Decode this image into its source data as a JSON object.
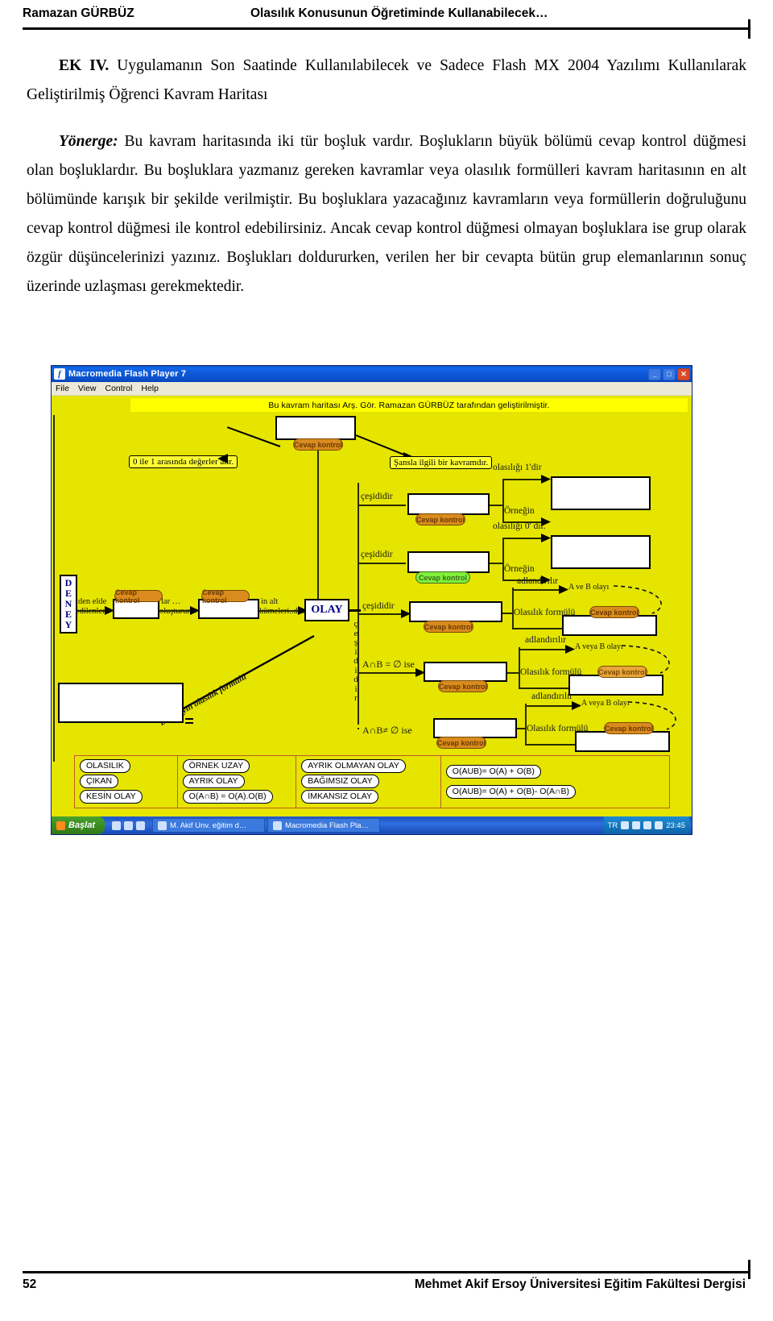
{
  "running_head": {
    "left": "Ramazan GÜRBÜZ",
    "right": "Olasılık Konusunun Öğretiminde Kullanabilecek…"
  },
  "document": {
    "ek_label": "EK IV.",
    "ek_title": " Uygulamanın Son Saatinde Kullanılabilecek ve Sadece Flash MX 2004 Yazılımı Kullanılarak Geliştirilmiş Öğrenci Kavram Haritası",
    "yonerge_label": "Yönerge:",
    "yonerge_text": " Bu kavram haritasında iki tür boşluk vardır. Boşlukların büyük bölümü cevap kontrol düğmesi olan boşluklardır. Bu boşluklara yazmanız gereken kavramlar veya olasılık formülleri kavram haritasının en alt bölümünde karışık bir şekilde verilmiştir. Bu boşluklara yazacağınız kavramların veya formüllerin doğruluğunu cevap kontrol düğmesi ile kontrol edebilirsiniz. Ancak cevap kontrol düğmesi olmayan boşluklara ise grup olarak özgür düşüncelerinizi yazınız. Boşlukları doldururken, verilen her bir cevapta bütün grup elemanlarının sonuç üzerinde uzlaşması gerekmektedir."
  },
  "flash_window": {
    "title": "Macromedia Flash Player 7",
    "icon": "flash-icon",
    "window_buttons": {
      "minimize": "_",
      "maximize": "□",
      "close": "✕"
    },
    "menu": [
      "File",
      "View",
      "Control",
      "Help"
    ]
  },
  "stage": {
    "banner": "Bu kavram haritası Arş. Gör. Ramazan GÜRBÜZ tarafından geliştirilmiştir.",
    "background_color": "#e5e500",
    "banner_color": "#ffff00",
    "labels": {
      "zero_one": "0 ile 1 arasında değerler alır.",
      "sans": "Şansla ilgili bir kavramdır.",
      "deney": "DENEY",
      "olay": "OLAY",
      "den_elde": "den elde",
      "edilenler": "edilenler",
      "lar": "lar …",
      "olusturur": "oluşturur",
      "in_alt": "in alt",
      "kumeleri": "kümeleri..dır.",
      "bir_olayin": "Bir olayın olasılık formülü",
      "cesididir_1": "çeşididir",
      "cesididir_2": "çeşididir",
      "cesididir_3": "çeşididir",
      "cesididir_vertical": "çeşididir",
      "olasiligi_1": "olasılığı 1'dir",
      "olasiligi_0": "olasılığı 0' dır.",
      "ornegin_1": "Örneğin",
      "ornegin_2": "Örneğin",
      "adlandirilir_1": "adlandırılır",
      "adlandirilir_2": "adlandırılır",
      "adlandirilir_3": "adlandırılır",
      "a_ve_b": "A ve B olayı",
      "a_veya_b_1": "A veya B olayı",
      "a_veya_b_2": "A veya B olayı",
      "formul_1": "Olasılık formülü",
      "formul_2": "Olasılık formülü",
      "formul_3": "Olasılık formülü",
      "anb_bos": "A∩B = ∅ ise",
      "anb_degil": "A∩B≠ ∅ ise"
    },
    "buttons": {
      "cevap_kontrol": "Cevap kontrol"
    }
  },
  "legend": {
    "columns": [
      {
        "items": [
          "OLASILIK",
          "ÇIKAN",
          "KESİN OLAY"
        ]
      },
      {
        "items": [
          "ÖRNEK UZAY",
          "AYRIK OLAY",
          "O(A∩B) = O(A).O(B)"
        ]
      },
      {
        "items": [
          "AYRIK OLMAYAN OLAY",
          "BAĞIMSIZ OLAY",
          "İMKANSIZ OLAY"
        ]
      },
      {
        "items": [
          "O(AUB)= O(A) + O(B)",
          "O(AUB)= O(A) + O(B)- O(A∩B)"
        ]
      }
    ]
  },
  "taskbar": {
    "start": "Başlat",
    "tasks": [
      "M. Akif Unv. eğitim d…",
      "Macromedia Flash Pla…"
    ],
    "tray_lang": "TR",
    "clock": "23:45"
  },
  "footer": {
    "page": "52",
    "journal": "Mehmet Akif Ersoy Üniversitesi Eğitim Fakültesi Dergisi"
  }
}
